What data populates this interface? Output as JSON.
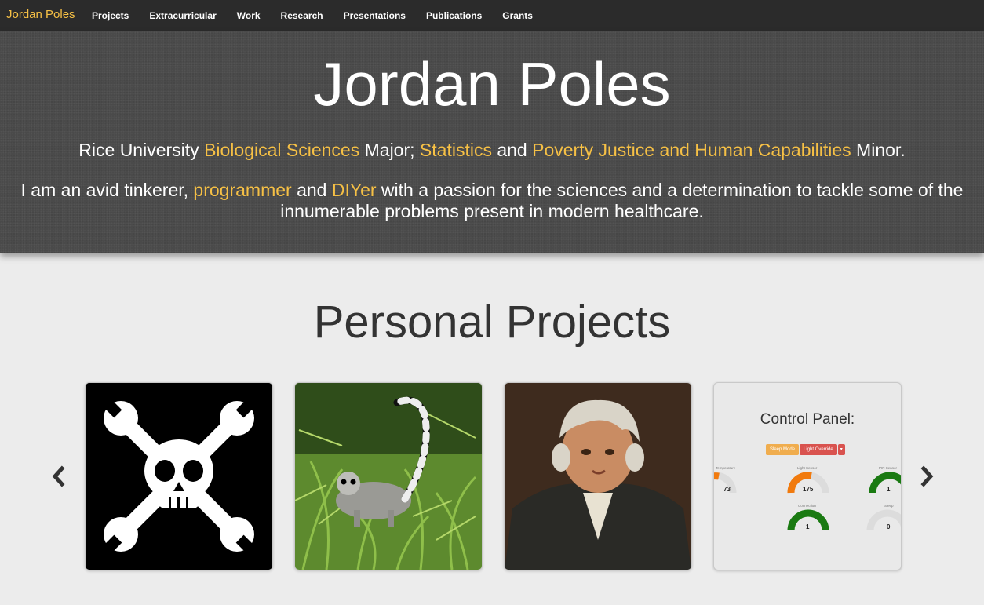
{
  "nav": {
    "brand": "Jordan Poles",
    "items": [
      "Projects",
      "Extracurricular",
      "Work",
      "Research",
      "Presentations",
      "Publications",
      "Grants"
    ]
  },
  "hero": {
    "title": "Jordan Poles",
    "line1": {
      "t1": "Rice University ",
      "l1": "Biological Sciences",
      "t2": " Major; ",
      "l2": "Statistics",
      "t3": " and ",
      "l3": "Poverty Justice and Human Capabilities",
      "t4": " Minor."
    },
    "line2": {
      "t1": "I am an avid tinkerer, ",
      "l1": "programmer",
      "t2": " and ",
      "l2": "DIYer",
      "t3": " with a passion for the sciences and a determination to tackle some of the innumerable problems present in modern healthcare."
    }
  },
  "projects": {
    "title": "Personal Projects",
    "cards": [
      "hackerspace-skull-wrenches",
      "ring-tailed-lemur",
      "portrait-painting",
      "control-panel"
    ],
    "control_panel": {
      "title": "Control Panel:",
      "buttons": [
        "Sleep Mode",
        "Light Override",
        "▾"
      ],
      "gauges": [
        {
          "label": "Temperature",
          "value": "73"
        },
        {
          "label": "Light Sensor",
          "value": "175"
        },
        {
          "label": "PIR Sensor",
          "value": "1"
        },
        {
          "label": "Connection",
          "value": "1"
        },
        {
          "label": "Sleep",
          "value": "0"
        }
      ]
    }
  },
  "colors": {
    "accent": "#f6c045",
    "navbar": "#2b2b2b",
    "hero": "#4a4a4a"
  }
}
